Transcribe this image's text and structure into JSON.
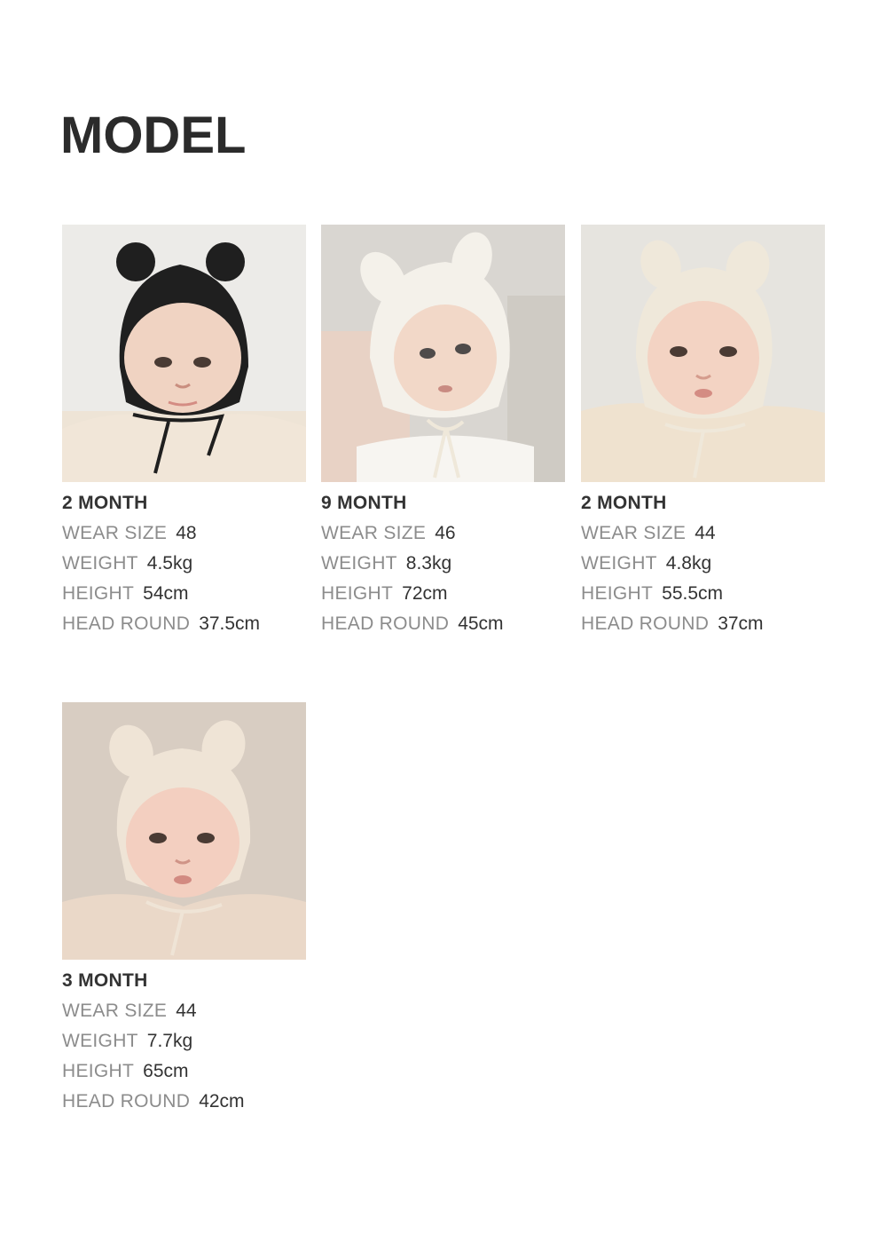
{
  "page": {
    "title": "MODEL"
  },
  "models": [
    {
      "age": "2 MONTH",
      "bonnet_color": "#1f1f1f",
      "background_color": "#ecebe8",
      "specs": [
        {
          "label": "WEAR SIZE",
          "value": "48"
        },
        {
          "label": "WEIGHT",
          "value": "4.5kg"
        },
        {
          "label": "HEIGHT",
          "value": "54cm"
        },
        {
          "label": "HEAD ROUND",
          "value": "37.5cm"
        }
      ]
    },
    {
      "age": "9 MONTH",
      "bonnet_color": "#f4f1ea",
      "background_color": "#d9d6d1",
      "specs": [
        {
          "label": "WEAR SIZE",
          "value": "46"
        },
        {
          "label": "WEIGHT",
          "value": "8.3kg"
        },
        {
          "label": "HEIGHT",
          "value": "72cm"
        },
        {
          "label": "HEAD ROUND",
          "value": "45cm"
        }
      ]
    },
    {
      "age": "2 MONTH",
      "bonnet_color": "#efe8da",
      "background_color": "#e6e4df",
      "specs": [
        {
          "label": "WEAR SIZE",
          "value": "44"
        },
        {
          "label": "WEIGHT",
          "value": "4.8kg"
        },
        {
          "label": "HEIGHT",
          "value": "55.5cm"
        },
        {
          "label": "HEAD ROUND",
          "value": "37cm"
        }
      ]
    },
    {
      "age": "3 MONTH",
      "bonnet_color": "#efe4d6",
      "background_color": "#d8cdc2",
      "specs": [
        {
          "label": "WEAR SIZE",
          "value": "44"
        },
        {
          "label": "WEIGHT",
          "value": "7.7kg"
        },
        {
          "label": "HEIGHT",
          "value": "65cm"
        },
        {
          "label": "HEAD ROUND",
          "value": "42cm"
        }
      ]
    }
  ]
}
